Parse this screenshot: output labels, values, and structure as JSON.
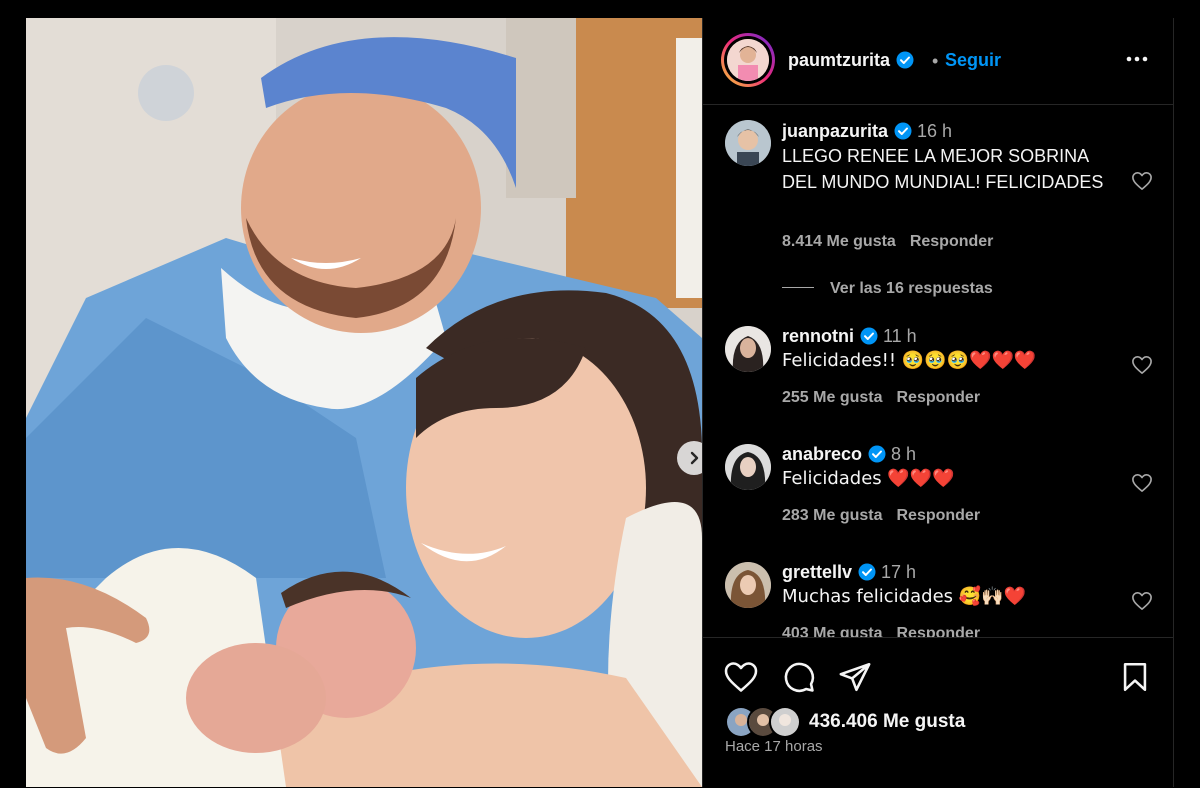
{
  "post": {
    "photo_alt_icon": "photo",
    "next_icon": "chevron-right-icon"
  },
  "header": {
    "username": "paumtzurita",
    "separator": "•",
    "follow_label": "Seguir"
  },
  "comments": [
    {
      "username": "juanpazurita",
      "time": "16 h",
      "text": "LLEGO RENEE LA MEJOR SOBRINA DEL MUNDO MUNDIAL! FELICIDADES",
      "likes": "8.414 Me gusta",
      "reply_label": "Responder",
      "view_replies": "Ver las 16 respuestas"
    },
    {
      "username": "rennotni",
      "time": "11 h",
      "text": "Felicidades!! 🥹🥹🥹❤️❤️❤️",
      "likes": "255 Me gusta",
      "reply_label": "Responder"
    },
    {
      "username": "anabreco",
      "time": "8 h",
      "text": "Felicidades ❤️❤️❤️",
      "likes": "283 Me gusta",
      "reply_label": "Responder"
    },
    {
      "username": "grettellv",
      "time": "17 h",
      "text": "Muchas felicidades 🥰🙌🏻❤️",
      "likes": "403 Me gusta",
      "reply_label": "Responder"
    }
  ],
  "footer": {
    "likes_count": "436.406 Me gusta",
    "posted_ago": "Hace 17 horas"
  },
  "colors": {
    "accent": "#0095f6",
    "verified": "#0095f6",
    "background": "#000000",
    "secondary_text": "#a8a8a8"
  }
}
